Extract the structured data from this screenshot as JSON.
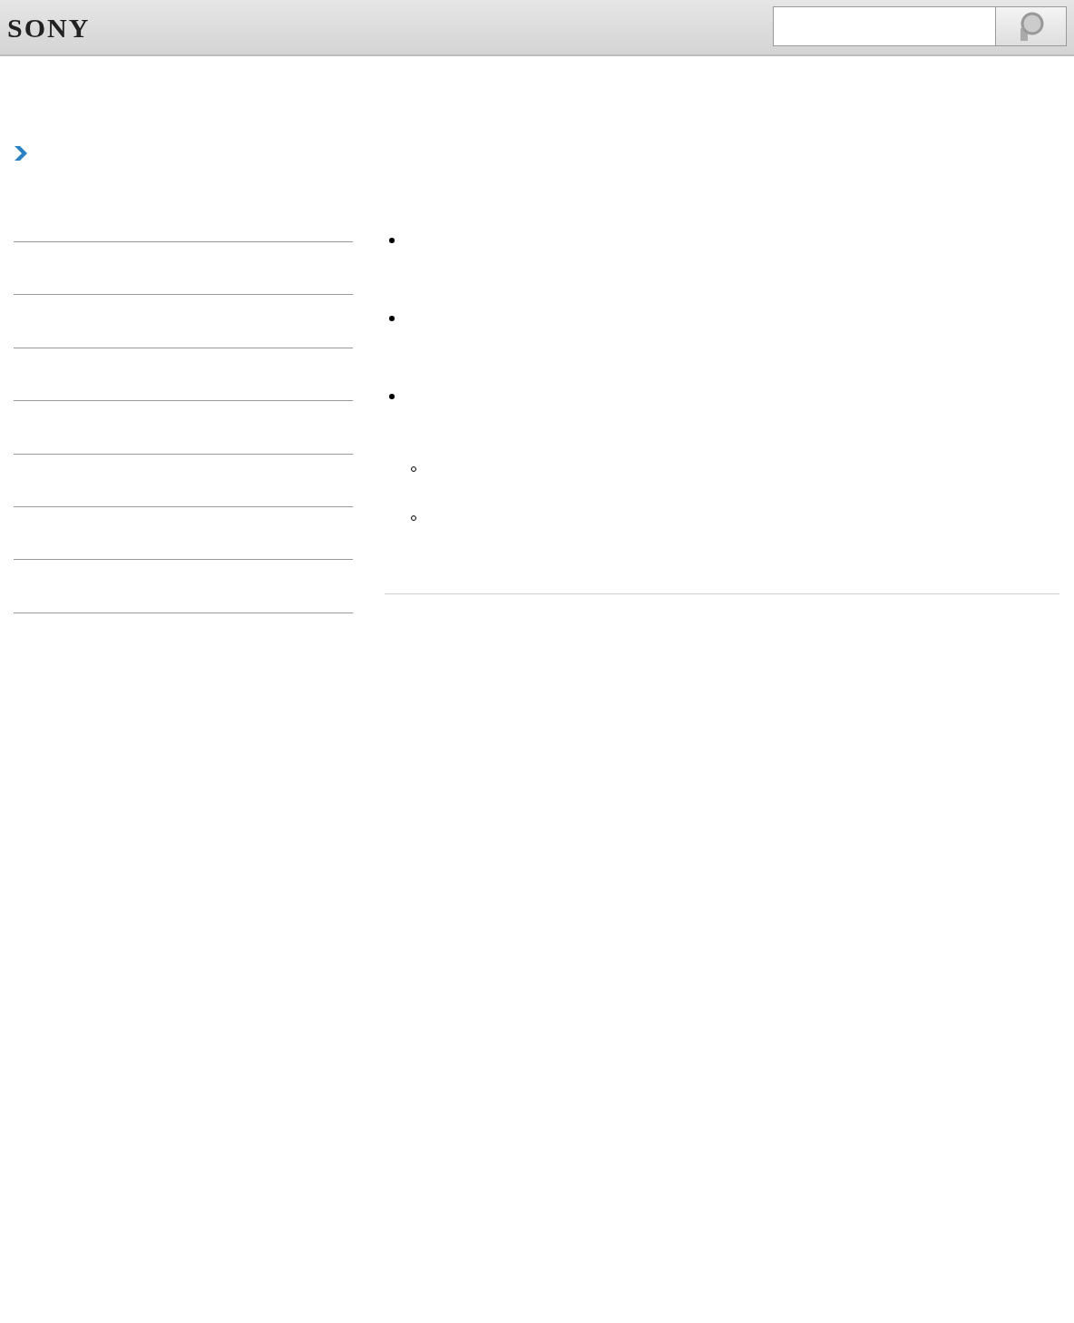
{
  "header": {
    "logo": "SONY"
  },
  "bullets": [
    {
      "kind": "filled"
    },
    {
      "kind": "filled"
    },
    {
      "kind": "filled",
      "children": [
        {
          "kind": "hollow"
        },
        {
          "kind": "hollow"
        }
      ]
    }
  ]
}
